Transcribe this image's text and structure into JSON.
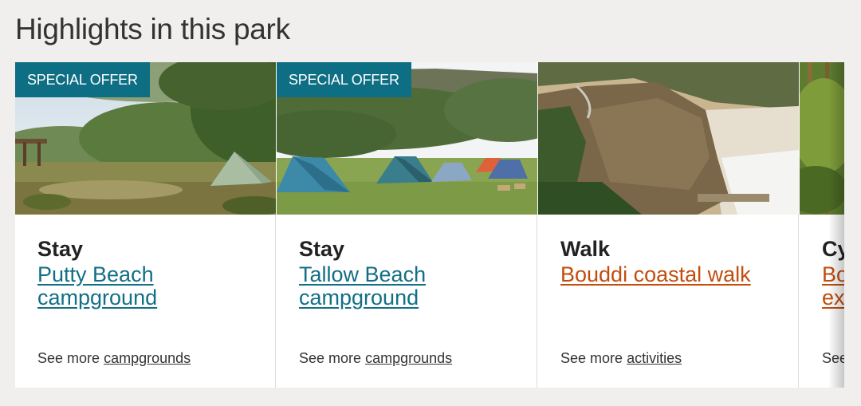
{
  "section": {
    "heading": "Highlights in this park"
  },
  "cards": [
    {
      "badge": "SPECIAL OFFER",
      "category": "Stay",
      "title_line1": "Putty Beach",
      "title_line2": "campground",
      "see_more_prefix": "See more",
      "see_more_link": "campgrounds",
      "link_color": "#126f85"
    },
    {
      "badge": "SPECIAL OFFER",
      "category": "Stay",
      "title_line1": "Tallow Beach",
      "title_line2": "campground",
      "see_more_prefix": "See more",
      "see_more_link": "campgrounds",
      "link_color": "#126f85"
    },
    {
      "category": "Walk",
      "title_line1": "Bouddi coastal walk",
      "see_more_prefix": "See more",
      "see_more_link": "activities",
      "link_color": "#c24d0d"
    },
    {
      "category": "Cy",
      "title_line1": "Bo",
      "title_line2": "ex",
      "see_more_prefix": "See",
      "link_color": "#c24d0d"
    }
  ],
  "colors": {
    "badge_background": "#0e6e83",
    "page_background": "#f0efed"
  }
}
